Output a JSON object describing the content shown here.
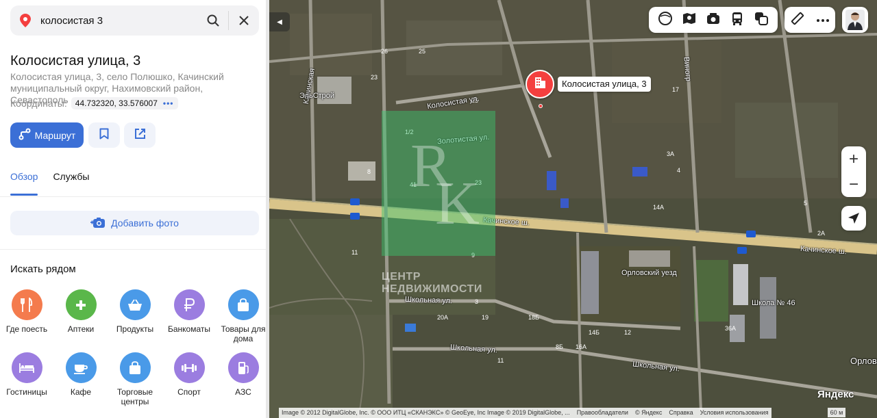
{
  "search": {
    "query": "колосистая 3",
    "pin_icon": "location-pin-icon",
    "search_icon": "search-icon",
    "close_icon": "close-icon"
  },
  "place": {
    "title": "Колосистая улица, 3",
    "address": "Колосистая улица, 3, село Полюшко, Качинский муниципальный округ, Нахимовский район, Севастополь",
    "coords_label": "Координаты:",
    "coords_value": "44.732320, 33.576007",
    "coords_more": "•••"
  },
  "actions": {
    "route_label": "Маршрут",
    "route_icon": "route-icon",
    "bookmark_icon": "bookmark-icon",
    "share_icon": "share-icon"
  },
  "tabs": [
    {
      "label": "Обзор",
      "active": true
    },
    {
      "label": "Службы",
      "active": false
    }
  ],
  "add_photo": {
    "label": "Добавить фото",
    "icon": "camera-plus-icon"
  },
  "nearby": {
    "title": "Искать рядом",
    "categories": [
      {
        "label": "Где поесть",
        "icon": "fork-knife-icon",
        "color": "#f47b4d"
      },
      {
        "label": "Аптеки",
        "icon": "pharmacy-cross-icon",
        "color": "#5ab74a"
      },
      {
        "label": "Продукты",
        "icon": "basket-icon",
        "color": "#4a9ae8"
      },
      {
        "label": "Банкоматы",
        "icon": "ruble-icon",
        "color": "#9b7de0"
      },
      {
        "label": "Товары для дома",
        "icon": "shopping-bag-icon",
        "color": "#4a9ae8"
      },
      {
        "label": "Гостиницы",
        "icon": "bed-icon",
        "color": "#9b7de0"
      },
      {
        "label": "Кафе",
        "icon": "coffee-cup-icon",
        "color": "#4a9ae8"
      },
      {
        "label": "Торговые центры",
        "icon": "shopping-bag-icon",
        "color": "#4a9ae8"
      },
      {
        "label": "Спорт",
        "icon": "dumbbell-icon",
        "color": "#9b7de0"
      },
      {
        "label": "АЗС",
        "icon": "fuel-pump-icon",
        "color": "#9b7de0"
      }
    ]
  },
  "map": {
    "marker_label": "Колосистая улица, 3",
    "streets": {
      "kolosistaya": "Колосистая ул.",
      "zolotistaya": "Золотистая ул.",
      "kachinskoe_1": "Качинское ш.",
      "kachinskoe_2": "Качинское ш.",
      "shkolnaya_1": "Школьная ул.",
      "shkolnaya_2": "Школьная ул.",
      "shkolnaya_3": "Школьная ул.",
      "kachinskaya": "Качинская",
      "orlovka": "Орловк",
      "vinogradnaya": "Виногр"
    },
    "pois": {
      "elstroy": "ЭльСтрой",
      "orlovsky": "Орловский уезд",
      "school": "Школа № 46"
    },
    "house_numbers": [
      "26",
      "25",
      "23",
      "25",
      "17",
      "11",
      "9",
      "8",
      "1/2",
      "41",
      "23",
      "14А",
      "1",
      "20А",
      "3",
      "19",
      "18Б",
      "14Б",
      "12",
      "16А",
      "8Б",
      "11",
      "36А",
      "2А",
      "3А",
      "4",
      "5"
    ],
    "watermark_text": [
      "ЦЕНТР",
      "НЕДВИЖИМОСТИ"
    ],
    "attribution": [
      "Image © 2012 DigitalGlobe, Inc. © ООО ИТЦ «СКАНЭКС» © GeoEye, Inc Image © 2019 DigitalGlobe, ...",
      "Правообладатели",
      "© Яндекс",
      "Справка",
      "Условия использования"
    ],
    "logo": "Яндекс",
    "scale": "60 м",
    "zoom_in": "+",
    "zoom_out": "−",
    "layer_icons": [
      "map-layers-icon",
      "satellite-map-icon",
      "panorama-camera-icon",
      "transit-bus-icon",
      "traffic-icon"
    ],
    "tool_icons": [
      "ruler-icon",
      "more-dots-icon"
    ]
  }
}
